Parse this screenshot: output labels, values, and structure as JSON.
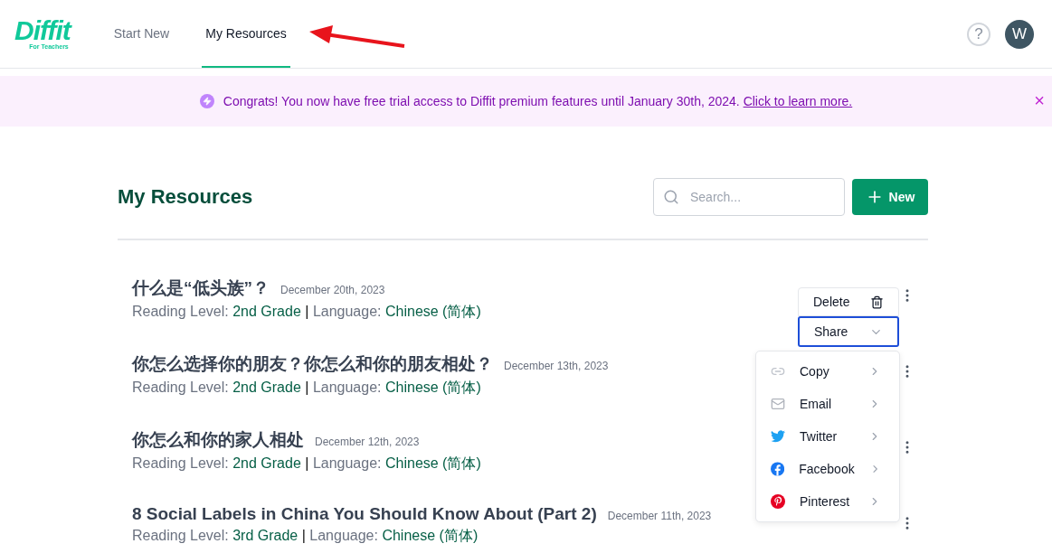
{
  "header": {
    "logo": "Diffit",
    "logo_sub": "For Teachers",
    "nav": [
      {
        "label": "Start New",
        "selected": false
      },
      {
        "label": "My Resources",
        "selected": true
      }
    ],
    "help": "?",
    "avatar": "W"
  },
  "banner": {
    "text": "Congrats! You now have free trial access to Diffit premium features until January 30th, 2024.",
    "link": "Click to learn more.",
    "close": "×"
  },
  "page": {
    "title": "My Resources",
    "search": {
      "placeholder": "Search..."
    },
    "new_button": "New"
  },
  "resources": [
    {
      "title": "什么是“低头族”？",
      "date": "December 20th, 2023",
      "level_label": "Reading Level:",
      "grade": "2nd Grade",
      "separator": "|",
      "language_label": "Language:",
      "language": "Chinese (简体)"
    },
    {
      "title": "你怎么选择你的朋友？你怎么和你的朋友相处？",
      "date": "December 13th, 2023",
      "level_label": "Reading Level:",
      "grade": "2nd Grade",
      "separator": "|",
      "language_label": "Language:",
      "language": "Chinese (简体)"
    },
    {
      "title": "你怎么和你的家人相处",
      "date": "December 12th, 2023",
      "level_label": "Reading Level:",
      "grade": "2nd Grade",
      "separator": "|",
      "language_label": "Language:",
      "language": "Chinese (简体)"
    },
    {
      "title": "8 Social Labels in China You Should Know About (Part 2)",
      "date": "December 11th, 2023",
      "level_label": "Reading Level:",
      "grade": "3rd Grade",
      "separator": "|",
      "language_label": "Language:",
      "language": "Chinese (简体)"
    }
  ],
  "actions_menu": {
    "items": [
      {
        "label": "Delete",
        "kind": "delete",
        "selected": false
      },
      {
        "label": "Share",
        "kind": "share",
        "selected": true
      }
    ]
  },
  "share_menu": {
    "items": [
      {
        "label": "Copy",
        "kind": "link"
      },
      {
        "label": "Email",
        "kind": "email"
      },
      {
        "label": "Twitter",
        "kind": "twitter"
      },
      {
        "label": "Facebook",
        "kind": "facebook"
      },
      {
        "label": "Pinterest",
        "kind": "pinterest"
      }
    ]
  }
}
